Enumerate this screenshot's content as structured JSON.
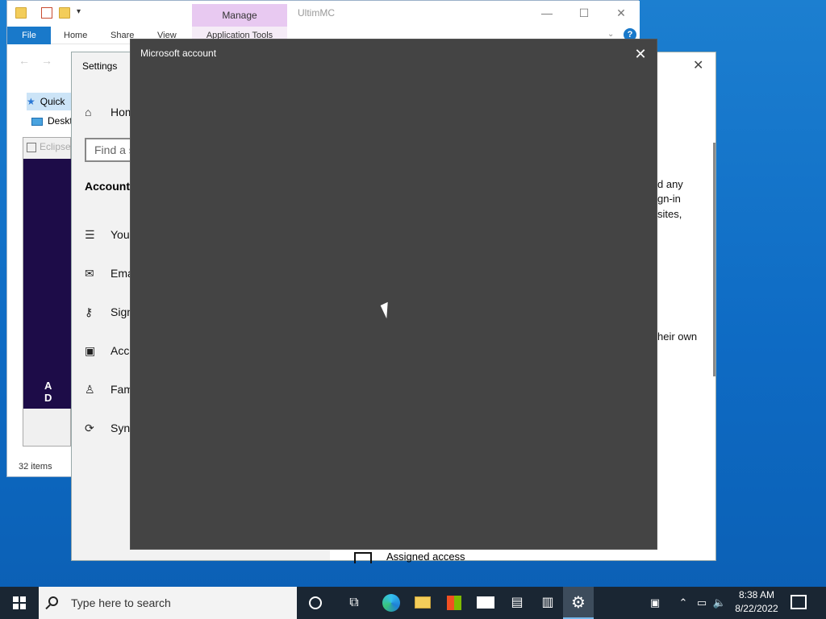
{
  "explorer": {
    "title": "UltimMC",
    "manage_tab": "Manage",
    "application_tools": "Application Tools",
    "ribbon_tabs": [
      "File",
      "Home",
      "Share",
      "View"
    ],
    "nav": {
      "quick_access": "Quick",
      "desktop": "Deskt"
    },
    "status_items": "32 items",
    "controls": {
      "minimize": "—",
      "maximize": "☐",
      "close": "✕"
    }
  },
  "eclipse": {
    "title": "Eclipse",
    "splash_text": "A D"
  },
  "settings": {
    "title": "Settings",
    "home": "Hom",
    "find_placeholder": "Find a s",
    "section": "Accounts",
    "items": [
      {
        "label": "Your",
        "icon": "person-list-icon"
      },
      {
        "label": "Ema",
        "icon": "mail-icon"
      },
      {
        "label": "Sign",
        "icon": "key-icon"
      },
      {
        "label": "Acce",
        "icon": "briefcase-icon"
      },
      {
        "label": "Fam",
        "icon": "add-person-icon"
      },
      {
        "label": "Sync",
        "icon": "sync-icon"
      }
    ],
    "right_fragments": [
      "d any",
      "gn-in",
      "sites,",
      "heir own"
    ],
    "assigned_access": "Assigned access"
  },
  "dialog": {
    "title": "Microsoft account",
    "close": "✕"
  },
  "taskbar": {
    "search_placeholder": "Type here to search",
    "time": "8:38 AM",
    "date": "8/22/2022"
  },
  "colors": {
    "desktop": "#0e6bc4",
    "dialog_bg": "#444444",
    "taskbar": "#1a2633",
    "accent": "#1979ca"
  }
}
